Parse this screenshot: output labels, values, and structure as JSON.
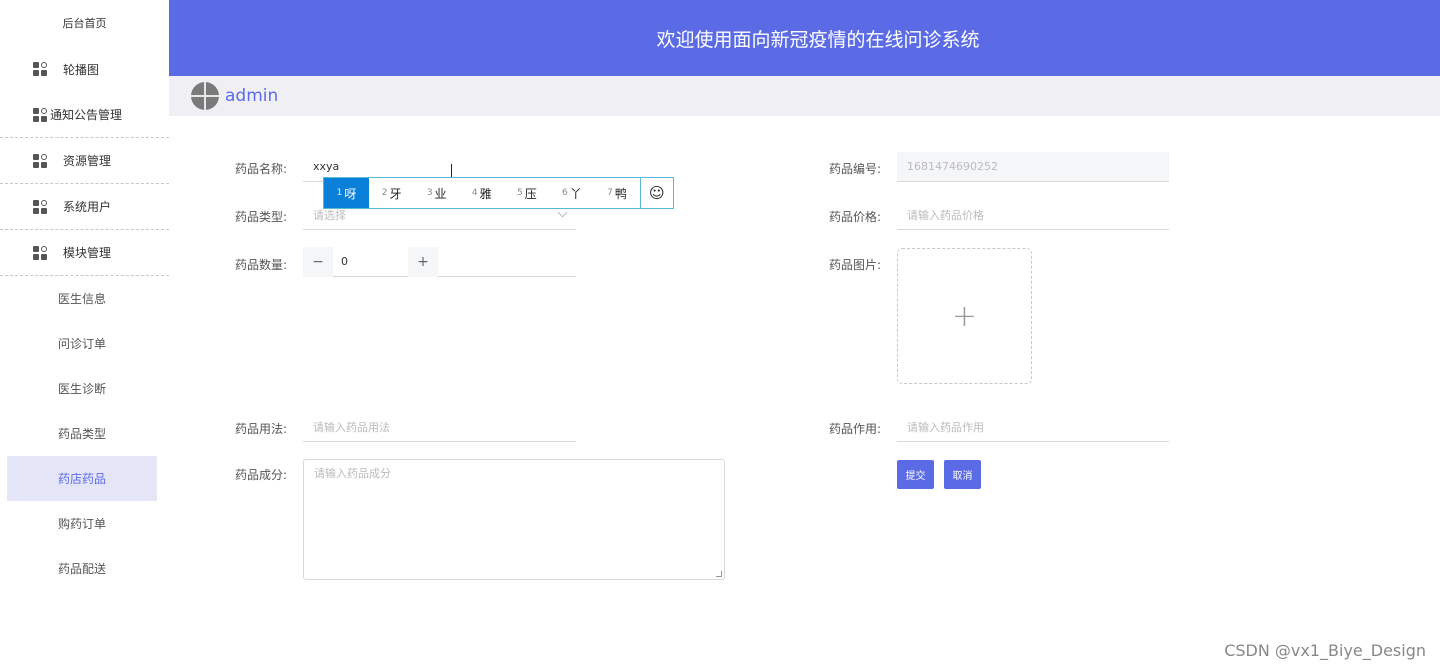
{
  "sidebar": {
    "title": "后台首页",
    "groups": [
      {
        "label": "轮播图"
      },
      {
        "label": "通知公告管理"
      },
      {
        "label": "资源管理"
      },
      {
        "label": "系统用户"
      },
      {
        "label": "模块管理"
      }
    ],
    "sub_items": [
      {
        "label": "医生信息"
      },
      {
        "label": "问诊订单"
      },
      {
        "label": "医生诊断"
      },
      {
        "label": "药品类型"
      },
      {
        "label": "药店药品"
      },
      {
        "label": "购药订单"
      },
      {
        "label": "药品配送"
      }
    ],
    "active_sub_item": "药店药品"
  },
  "header": {
    "title": "欢迎使用面向新冠疫情的在线问诊系统",
    "username": "admin"
  },
  "form": {
    "name": {
      "label": "药品名称:",
      "value": "xxya"
    },
    "code": {
      "label": "药品编号:",
      "value": "1681474690252"
    },
    "category": {
      "label": "药品类型:",
      "placeholder": "请选择"
    },
    "price": {
      "label": "药品价格:",
      "placeholder": "请输入药品价格"
    },
    "quantity": {
      "label": "药品数量:",
      "value": "0",
      "minus": "−",
      "plus": "+"
    },
    "image": {
      "label": "药品图片:",
      "plus": "+"
    },
    "usage": {
      "label": "药品用法:",
      "placeholder": "请输入药品用法"
    },
    "effect": {
      "label": "药品作用:",
      "placeholder": "请输入药品作用"
    },
    "ingredients": {
      "label": "药品成分:",
      "placeholder": "请输入药品成分"
    },
    "submit_label": "提交",
    "cancel_label": "取消"
  },
  "ime": {
    "candidates": [
      {
        "num": "1",
        "text": "呀"
      },
      {
        "num": "2",
        "text": "牙"
      },
      {
        "num": "3",
        "text": "业"
      },
      {
        "num": "4",
        "text": "雅"
      },
      {
        "num": "5",
        "text": "压"
      },
      {
        "num": "6",
        "text": "丫"
      },
      {
        "num": "7",
        "text": "鸭"
      }
    ],
    "emoji": "☺"
  },
  "watermark": "CSDN @vx1_Biye_Design"
}
